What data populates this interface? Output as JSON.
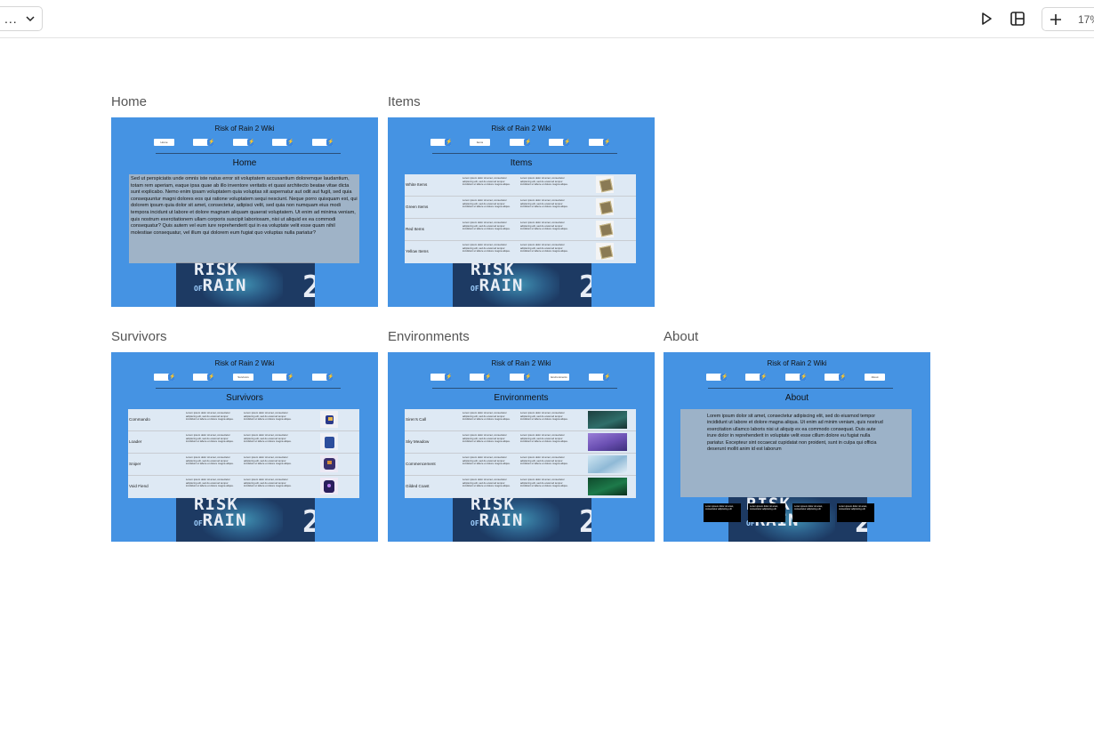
{
  "toolbar": {
    "page_select_label": "...",
    "zoom": "17%"
  },
  "site": {
    "title": "Risk of Rain 2 Wiki",
    "nav": [
      "Home",
      "Items",
      "Survivors",
      "Environments",
      "About"
    ],
    "logo_line1": "RISK",
    "logo_of": "OF",
    "logo_line2": "RAIN",
    "logo_two": "2"
  },
  "frames": {
    "home": {
      "label": "Home",
      "heading": "Home",
      "body": "Sed ut perspiciatis unde omnis iste natus error sit voluptatem accusantium doloremque laudantium, totam rem aperiam, eaque ipsa quae ab illo inventore veritatis et quasi architecto beatae vitae dicta sunt explicabo. Nemo enim ipsam voluptatem quia voluptas sit aspernatur aut odit aut fugit, sed quia consequuntur magni dolores eos qui ratione voluptatem sequi nesciunt. Neque porro quisquam est, qui dolorem ipsum quia dolor sit amet, consectetur, adipisci velit, sed quia non numquam eius modi tempora incidunt ut labore et dolore magnam aliquam quaerat voluptatem. Ut enim ad minima veniam, quis nostrum exercitationem ullam corporis suscipit laboriosam, nisi ut aliquid ex ea commodi consequatur? Quis autem vel eum iure reprehenderit qui in ea voluptate velit esse quam nihil molestiae consequatur, vel illum qui dolorem eum fugiat quo voluptas nulla pariatur?"
    },
    "items": {
      "label": "Items",
      "heading": "Items",
      "rows": [
        "White Items",
        "Green Items",
        "Red Items",
        "Yellow Items"
      ]
    },
    "survivors": {
      "label": "Survivors",
      "heading": "Survivors",
      "rows": [
        "Commando",
        "Loader",
        "Sniper",
        "Void Fiend"
      ]
    },
    "environments": {
      "label": "Environments",
      "heading": "Environments",
      "rows": [
        "Siren's Call",
        "Sky Meadow",
        "Commencement",
        "Gilded Coast"
      ]
    },
    "about": {
      "label": "About",
      "heading": "About",
      "body": "Lorem ipsum dolor sit amet, consectetur adipiscing elit, sed do eiusmod tempor incididunt ut labore et dolore magna aliqua. Ut enim ad minim veniam, quis nostrud exercitation ullamco laboris nisi ut aliquip ex ea commodo consequat. Duis aute irure dolor in reprehenderit in voluptate velit esse cillum dolore eu fugiat nulla pariatur. Excepteur sint occaecat cupidatat non proident, sunt in culpa qui officia deserunt mollit anim id est laborum",
      "card_text": "Lorem ipsum dolor sit amet, consectetur adipiscing elit"
    }
  },
  "lorem_short": "Lorem ipsum dolor sit amet, consectetur adipiscing elit, sed do eiusmod tempor incididunt ut labore et dolore magna aliqua.",
  "colors": {
    "frame_bg": "#4593e3",
    "hero_bg": "#1d3a63",
    "panel": "#bebebe"
  }
}
